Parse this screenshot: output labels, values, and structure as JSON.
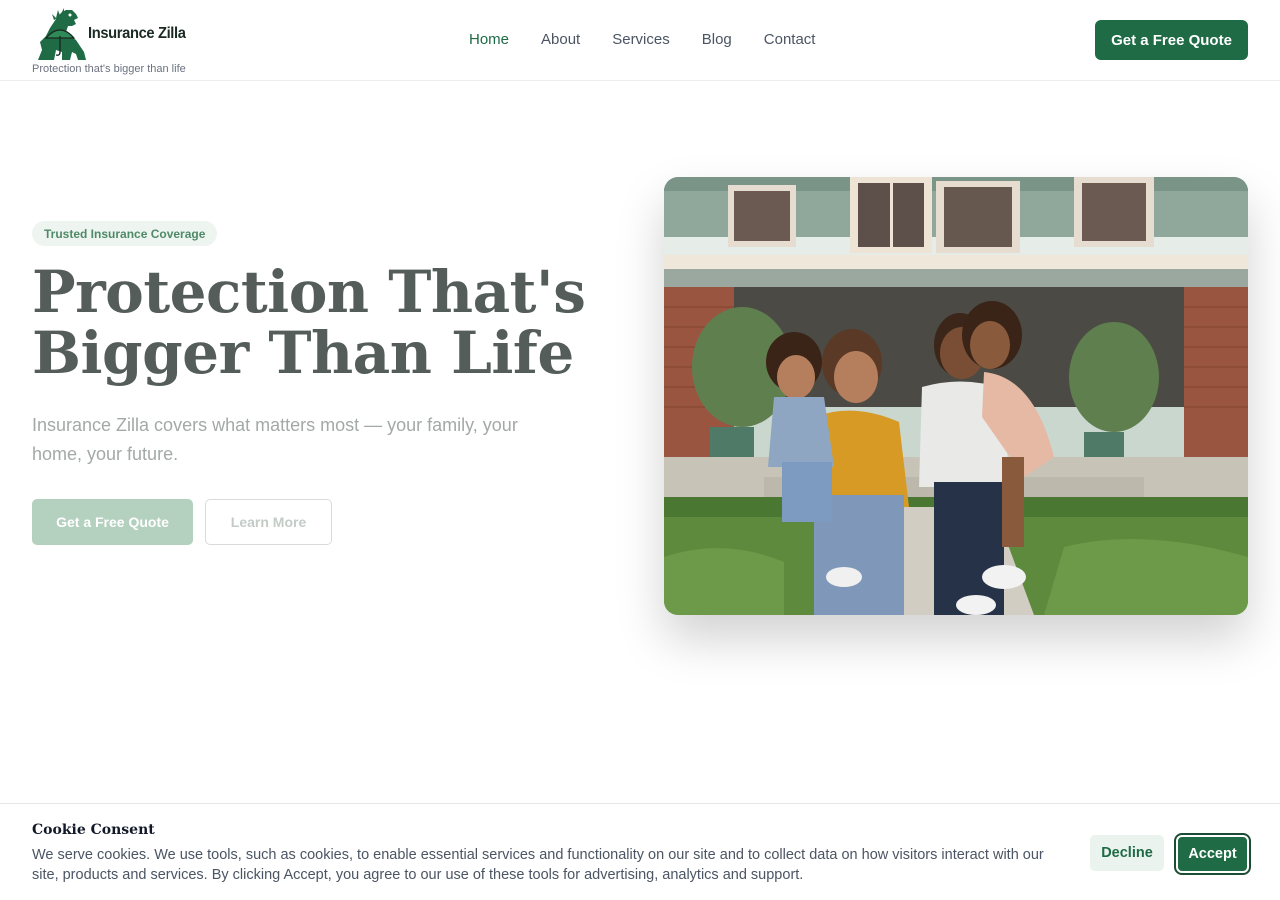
{
  "brand": {
    "name": "Insurance Zilla",
    "tagline": "Protection that's bigger than life",
    "primary_color": "#1e6b45"
  },
  "nav": {
    "items": [
      {
        "label": "Home",
        "active": true
      },
      {
        "label": "About",
        "active": false
      },
      {
        "label": "Services",
        "active": false
      },
      {
        "label": "Blog",
        "active": false
      },
      {
        "label": "Contact",
        "active": false
      }
    ],
    "cta_label": "Get a Free Quote"
  },
  "hero": {
    "badge": "Trusted Insurance Coverage",
    "title_line1": "Protection That's",
    "title_line2": "Bigger Than Life",
    "subtitle": "Insurance Zilla covers what matters most — your family, your home, your future.",
    "primary_button": "Get a Free Quote",
    "secondary_button": "Learn More"
  },
  "cookie": {
    "title": "Cookie Consent",
    "text": "We serve cookies. We use tools, such as cookies, to enable essential services and functionality on our site and to collect data on how visitors interact with our site, products and services. By clicking Accept, you agree to our use of these tools for advertising, analytics and support.",
    "decline_label": "Decline",
    "accept_label": "Accept"
  }
}
